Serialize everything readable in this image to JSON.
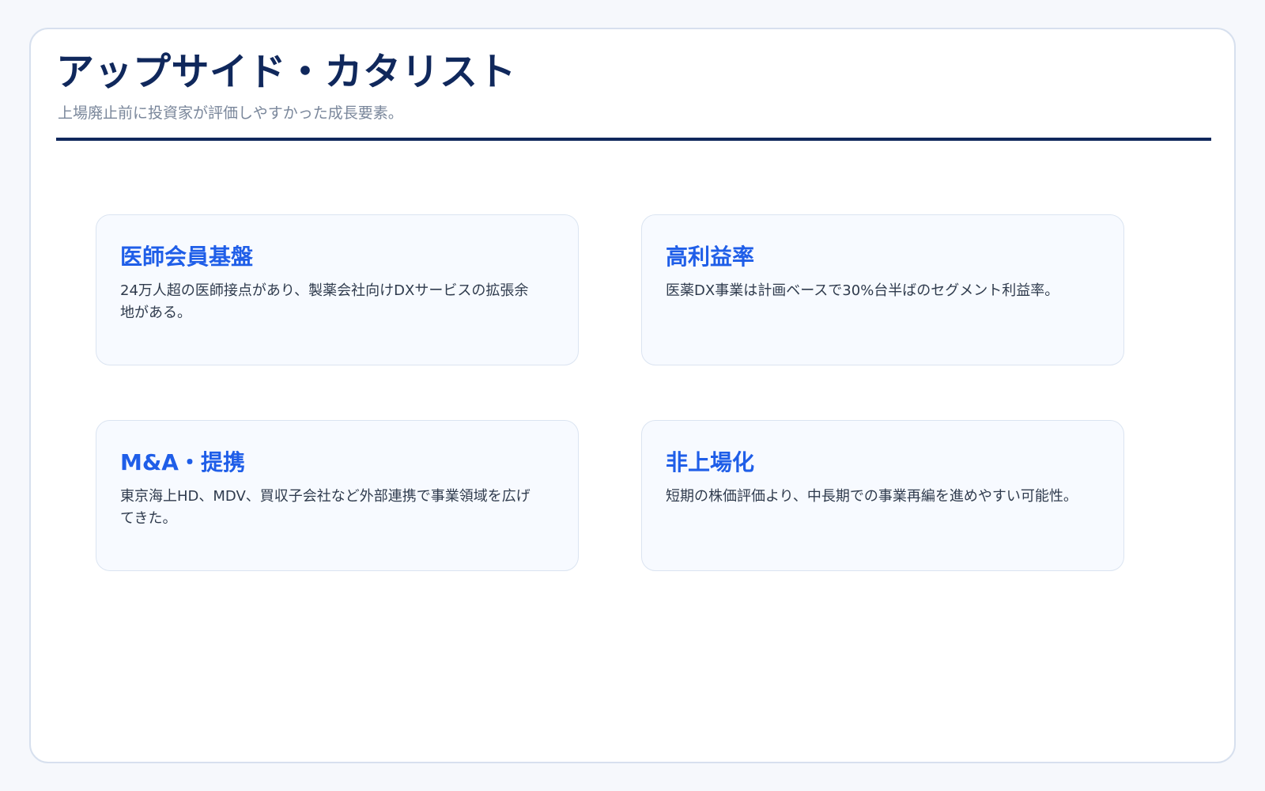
{
  "header": {
    "title": "アップサイド・カタリスト",
    "subtitle": "上場廃止前に投資家が評価しやすかった成長要素。"
  },
  "cards": [
    {
      "title": "医師会員基盤",
      "text": "24万人超の医師接点があり、製薬会社向けDXサービスの拡張余地がある。"
    },
    {
      "title": "高利益率",
      "text": "医薬DX事業は計画ベースで30%台半ばのセグメント利益率。"
    },
    {
      "title": "M&A・提携",
      "text": "東京海上HD、MDV、買収子会社など外部連携で事業領域を広げてきた。"
    },
    {
      "title": "非上場化",
      "text": "短期の株価評価より、中長期での事業再編を進めやすい可能性。"
    }
  ],
  "colors": {
    "title": "#10285c",
    "accent": "#1f5ee8",
    "text": "#2f3b4d",
    "muted": "#7a879b",
    "card_bg": "#f7faff",
    "border": "#dbe4f1"
  }
}
